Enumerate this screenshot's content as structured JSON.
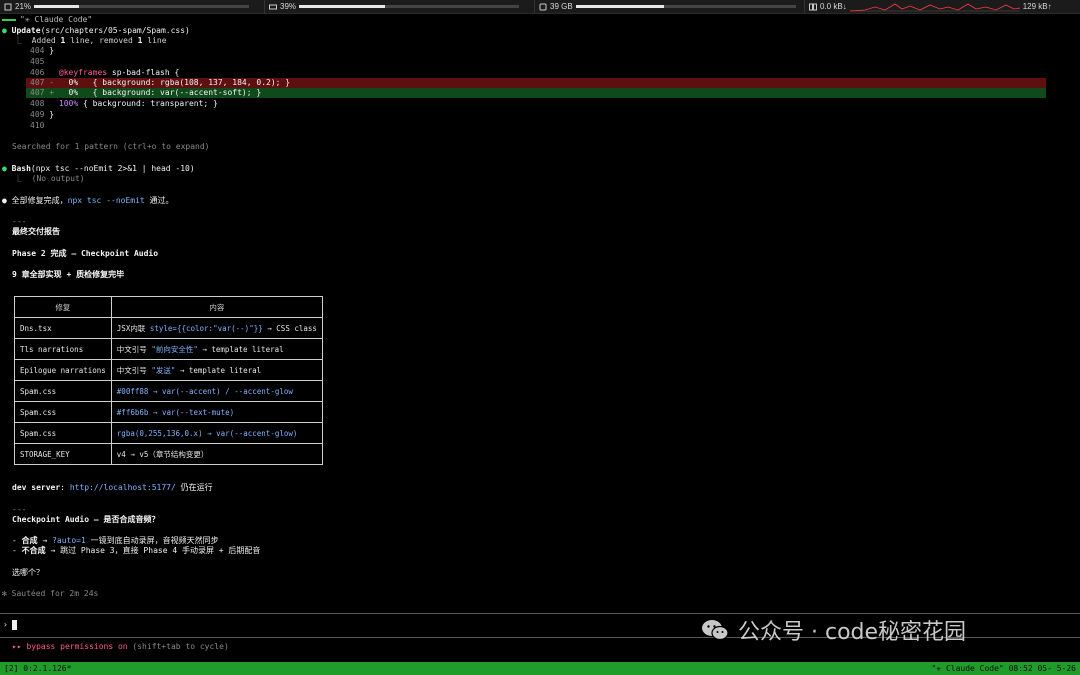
{
  "statbar": {
    "cpu_percent": "21%",
    "cpu_fill": 0.21,
    "mem_percent": "39%",
    "mem_fill": 0.39,
    "disk": "39 GB",
    "disk_fill": 0.4,
    "net_down": "0.0 kB↓",
    "net_up": "129 kB↑"
  },
  "window": {
    "title_line": "\"✳ Claude Code\""
  },
  "update": {
    "label": "Update",
    "path": "(src/chapters/05-spam/Spam.css)",
    "summary_pre": "Added ",
    "added": "1",
    "summary_mid": " line, removed ",
    "removed": "1",
    "summary_post": " line"
  },
  "diff": {
    "l404_num": "404",
    "l404_text": "}",
    "l405_num": "405",
    "l406_num": "406",
    "l406_kw": "@keyframes",
    "l406_text": " sp-bad-flash {",
    "l407del_num": "407 -",
    "l407del_text": "   0%   { background: rgba(108, 137, 184, 0.2); }",
    "l407add_num": "407 +",
    "l407add_text": "   0%   { background: var(--accent-soft); }",
    "l408_num": "408",
    "l408_pct": "   100%",
    "l408_text": " { background: transparent; }",
    "l409_num": "409",
    "l409_text": "}",
    "l410_num": "410"
  },
  "searched": "Searched for 1 pattern (ctrl+o to expand)",
  "bash": {
    "label": "Bash",
    "cmd": "(npx tsc --noEmit 2>&1 | head -10)",
    "output": "⎿  (No output)"
  },
  "done_line": {
    "pre": "全部修复完成，",
    "cmd": "npx tsc --noEmit",
    "post": " 通过。"
  },
  "sep1": "---",
  "report_title": "最终交付报告",
  "phase_line": "Phase 2 完成 — Checkpoint Audio",
  "chapters_line": "9 章全部实现 + 质检修复完毕",
  "table": {
    "headers": [
      "修复",
      "内容"
    ],
    "rows": [
      {
        "file": "Dns.tsx",
        "pre": "JSX内联 ",
        "code": "style={{color:\"var(--)\"}}",
        "post": " → CSS class"
      },
      {
        "file": "Tls narrations",
        "pre": "中文引号 ",
        "code": "\"前向安全性\"",
        "post": " → template literal"
      },
      {
        "file": "Epilogue narrations",
        "pre": "中文引号 ",
        "code": "\"发送\"",
        "post": " → template literal"
      },
      {
        "file": "Spam.css",
        "pre": "",
        "code": "#00ff88 → var(--accent) / --accent-glow",
        "post": ""
      },
      {
        "file": "Spam.css",
        "pre": "",
        "code": "#ff6b6b → var(--text-mute)",
        "post": ""
      },
      {
        "file": "Spam.css",
        "pre": "",
        "code": "rgba(0,255,136,0.x) → var(--accent-glow)",
        "post": ""
      },
      {
        "file": "STORAGE_KEY",
        "pre": "v4 → v5（章节结构变更）",
        "code": "",
        "post": ""
      }
    ]
  },
  "dev_server": {
    "label": "dev server",
    "colon": ": ",
    "url": "http://localhost:5177/",
    "post": " 仍在运行"
  },
  "sep2": "---",
  "question": "Checkpoint Audio — 是否合成音频？",
  "option1": {
    "dash": "- ",
    "bold": "合成",
    "arrow": " → ",
    "code": "?auto=1",
    "post": " 一镜到底自动录屏，音视频天然同步"
  },
  "option2": {
    "dash": "- ",
    "bold": "不合成",
    "post": " → 跳过 Phase 3，直接 Phase 4 手动录屏 + 后期配音"
  },
  "ask": "选哪个？",
  "timer": "✻ Sautéed for 2m 24s",
  "prompt_symbol": "›",
  "bypass": {
    "arrows": "▸▸ ",
    "text": "bypass permissions on",
    "hint": " (shift+tab to cycle)"
  },
  "tmux": {
    "left": "[2] 0:2.1.126*",
    "right": "\"✳ Claude Code\" 08:52 05- 5-26"
  },
  "watermark": "公众号 · code秘密花园",
  "colors": {
    "diff_del_bg": "#5e0f0f",
    "diff_add_bg": "#0f4a1a",
    "tmux_bar": "#1f9c2a",
    "bullet_green": "#3bdc6b",
    "link_blue": "#7fb3ff"
  }
}
